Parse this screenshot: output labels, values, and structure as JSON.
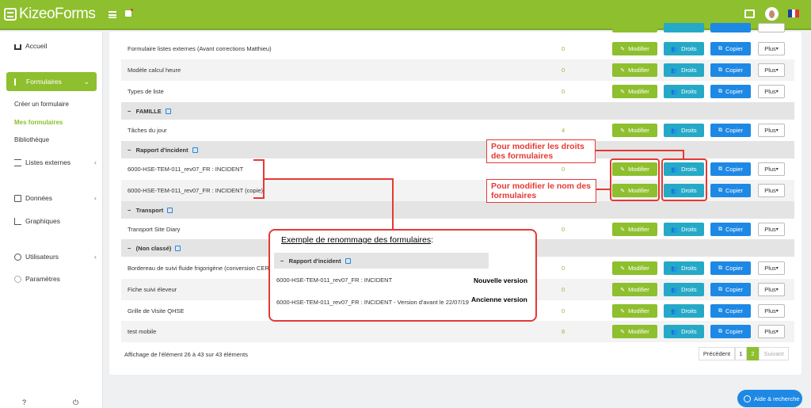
{
  "app": {
    "logo": "KizeoForms"
  },
  "colors": {
    "green": "#8ebf2e",
    "teal": "#26a9c6",
    "blue": "#1e88e5",
    "red": "#e53935"
  },
  "sidebar": {
    "home": "Accueil",
    "forms": "Formulaires",
    "create": "Créer un formulaire",
    "my_forms": "Mes formulaires",
    "library": "Bibliothèque",
    "ext_lists": "Listes externes",
    "data": "Données",
    "charts": "Graphiques",
    "users": "Utilisateurs",
    "settings": "Paramètres"
  },
  "labels": {
    "modifier": "Modifier",
    "droits": "Droits",
    "copier": "Copier",
    "plus": "Plus"
  },
  "rows": [
    {
      "name": "Formulaire listes externes (Avant corrections Matthieu)",
      "count": "0"
    },
    {
      "name": "Modèle calcul heure",
      "count": "0"
    },
    {
      "name": "Types de liste",
      "count": "0"
    },
    {
      "name": "Tâches du jour",
      "count": "4"
    },
    {
      "name": "6000-HSE-TEM-011_rev07_FR : INCIDENT",
      "count": "0"
    },
    {
      "name": "6000-HSE-TEM-011_rev07_FR : INCIDENT (copie)",
      "count": "0"
    },
    {
      "name": "Transport Site Diary",
      "count": "0"
    },
    {
      "name": "Bordereau de suivi fluide frigorigène (conversion CERFA)",
      "count": "0"
    },
    {
      "name": "Fiche suivi éleveur",
      "count": "0"
    },
    {
      "name": "Grille de Visite QHSE",
      "count": "0"
    },
    {
      "name": "test mobile",
      "count": "8"
    }
  ],
  "groups": [
    "FAMILLE",
    "Rapport d'incident",
    "Transport",
    "(Non classé)"
  ],
  "footer": {
    "info": "Affichage de l'élément 26 à 43 sur 43 éléments"
  },
  "pagination": {
    "prev": "Précédent",
    "p1": "1",
    "p2": "2",
    "next": "Suivant"
  },
  "help": "Aide & recherche",
  "annotations": {
    "rights": "Pour modifier les droits des formulaires",
    "rename": "Pour modifier le nom des formulaires",
    "example_title": "Exemple de renommage des formulaires",
    "example_colon": ":",
    "example_group": "Rapport d'incident",
    "example_new_name": "6000-HSE-TEM-011_rev07_FR : INCIDENT",
    "example_old_name": "6000-HSE-TEM-011_rev07_FR : INCIDENT - Version d'avant le 22/07/19",
    "new_version": "Nouvelle version",
    "old_version": "Ancienne version"
  }
}
